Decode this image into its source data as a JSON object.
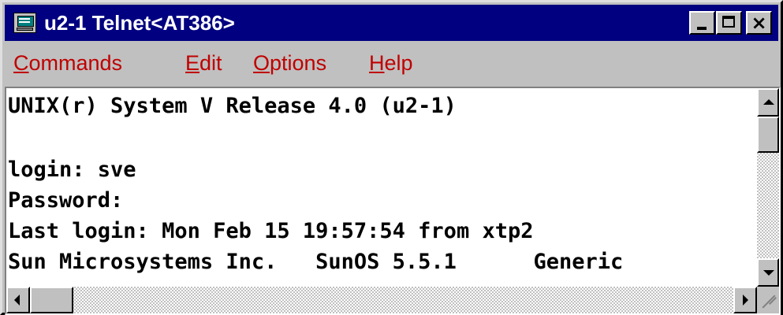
{
  "window": {
    "title": "u2-1 Telnet<AT386>",
    "icon": "telnet-terminal-icon",
    "buttons": {
      "minimize": "minimize-icon",
      "maximize": "maximize-icon",
      "close_label": "×"
    }
  },
  "menu": {
    "items": [
      {
        "mnemonic": "C",
        "rest": "ommands"
      },
      {
        "mnemonic": "E",
        "rest": "dit"
      },
      {
        "mnemonic": "O",
        "rest": "ptions"
      },
      {
        "mnemonic": "H",
        "rest": "elp"
      }
    ]
  },
  "terminal": {
    "lines": [
      "UNIX(r) System V Release 4.0 (u2-1)",
      "",
      "login: sve",
      "Password:",
      "Last login: Mon Feb 15 19:57:54 from xtp2",
      "Sun Microsystems Inc.   SunOS 5.5.1      Generic"
    ]
  },
  "colors": {
    "titlebar": "#000080",
    "menu_text": "#c00000",
    "terminal_bg": "#ffffff",
    "chrome": "#c0c0c0"
  }
}
